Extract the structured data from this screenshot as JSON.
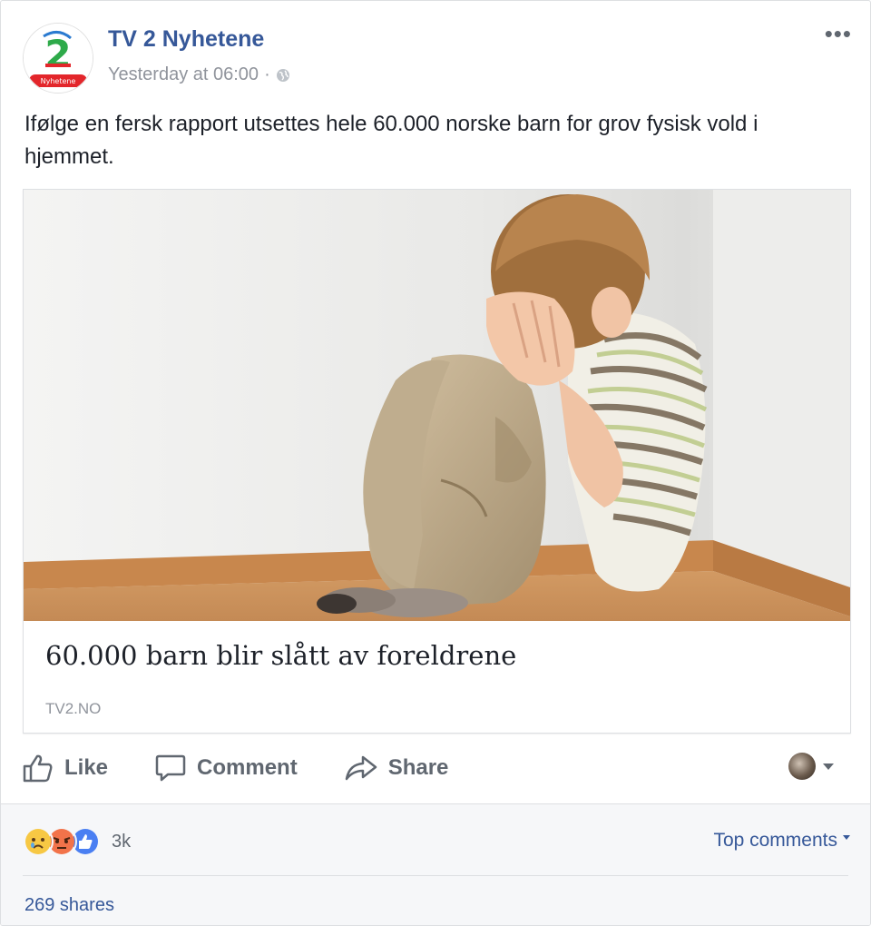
{
  "post": {
    "page_name": "TV 2 Nyhetene",
    "timestamp": "Yesterday at 06:00",
    "separator": "·",
    "privacy_icon": "globe-icon",
    "more_label": "•••",
    "text": "Ifølge en fersk rapport utsettes hele 60.000 norske barn for grov fysisk vold i hjemmet."
  },
  "logo": {
    "numeral": "2",
    "band_text": "Nyhetene",
    "band_color": "#e3262b"
  },
  "link": {
    "title": "60.000 barn blir slått av foreldrene",
    "domain": "TV2.NO",
    "image": "child-covering-face-photo"
  },
  "actions": {
    "like_label": "Like",
    "comment_label": "Comment",
    "share_label": "Share"
  },
  "footer": {
    "reaction_icons": [
      "sad-icon",
      "angry-icon",
      "like-reaction-icon"
    ],
    "reaction_count": "3k",
    "sort_label": "Top comments",
    "shares_label": "269 shares"
  },
  "colors": {
    "link_blue": "#365899",
    "meta_gray": "#90949c",
    "action_gray": "#606770"
  }
}
